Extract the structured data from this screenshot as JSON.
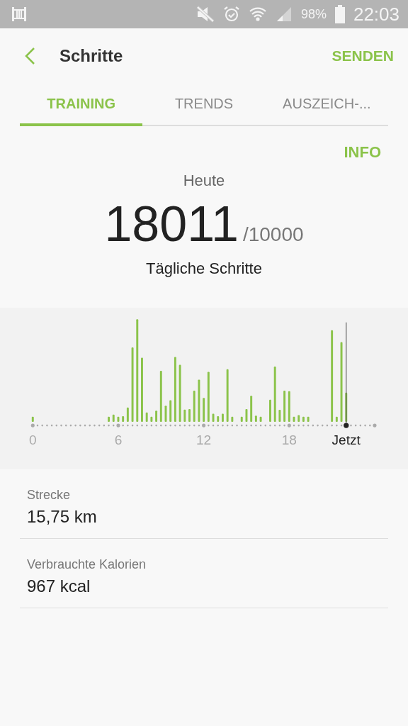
{
  "status_bar": {
    "battery": "98%",
    "time": "22:03"
  },
  "header": {
    "title": "Schritte",
    "action": "SENDEN"
  },
  "tabs": [
    {
      "label": "TRAINING",
      "selected": true
    },
    {
      "label": "TRENDS",
      "selected": false
    },
    {
      "label": "AUSZEICH-...",
      "selected": false
    }
  ],
  "info_link": "INFO",
  "summary": {
    "period": "Heute",
    "steps": "18011",
    "goal": "/10000",
    "caption": "Tägliche Schritte"
  },
  "chart": {
    "axis_labels": [
      {
        "label": "0",
        "current": false
      },
      {
        "label": "6",
        "current": false
      },
      {
        "label": "12",
        "current": false
      },
      {
        "label": "18",
        "current": false
      },
      {
        "label": "Jetzt",
        "current": true
      }
    ]
  },
  "stats": [
    {
      "label": "Strecke",
      "value": "15,75 km"
    },
    {
      "label": "Verbrauchte Kalorien",
      "value": "967 kcal"
    }
  ]
}
